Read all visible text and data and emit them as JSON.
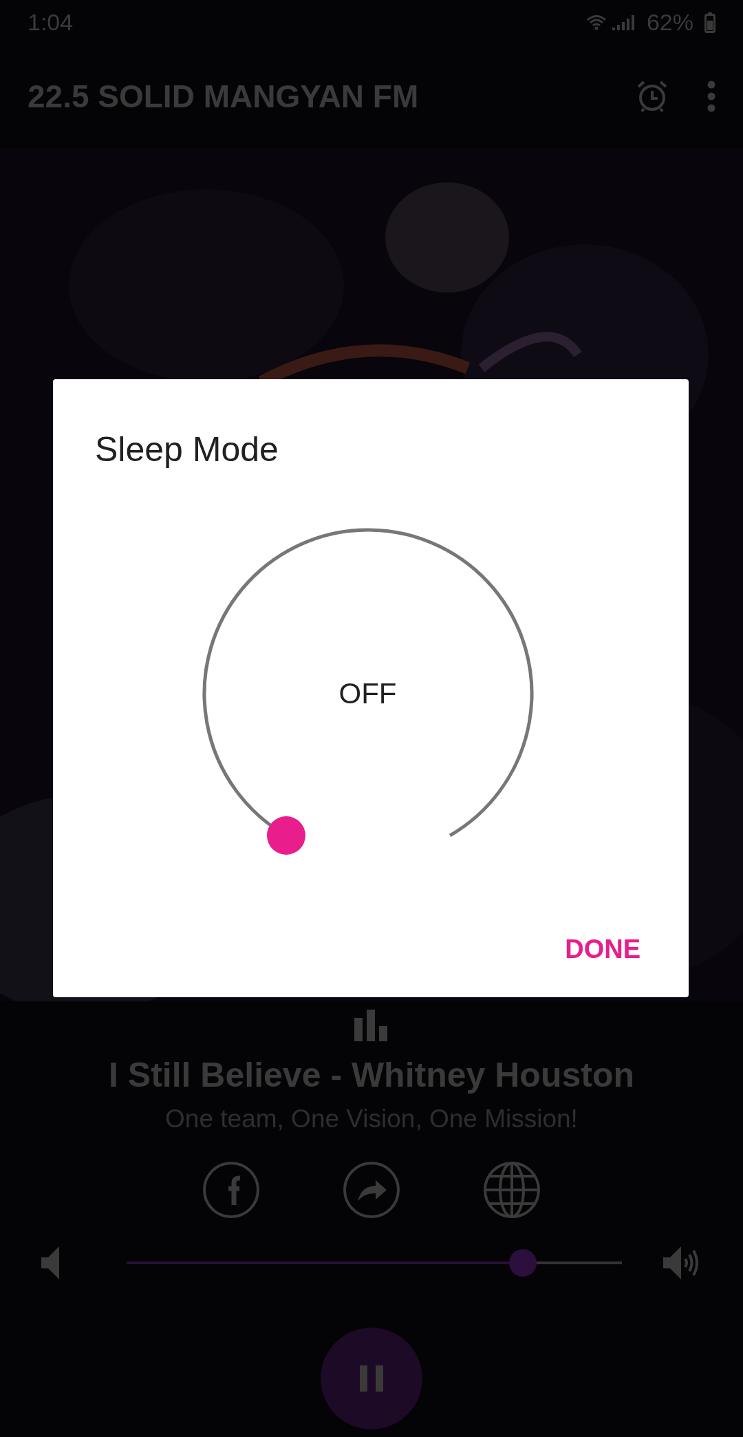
{
  "status_bar": {
    "time": "1:04",
    "battery": "62%"
  },
  "app_bar": {
    "title": "22.5 SOLID MANGYAN FM"
  },
  "now_playing": {
    "title": "I Still Believe - Whitney Houston",
    "tagline": "One team, One Vision, One Mission!"
  },
  "volume": {
    "level": 0.8
  },
  "dialog": {
    "title": "Sleep Mode",
    "timer": {
      "reading": "OFF"
    },
    "buttons": [
      "DONE"
    ]
  }
}
